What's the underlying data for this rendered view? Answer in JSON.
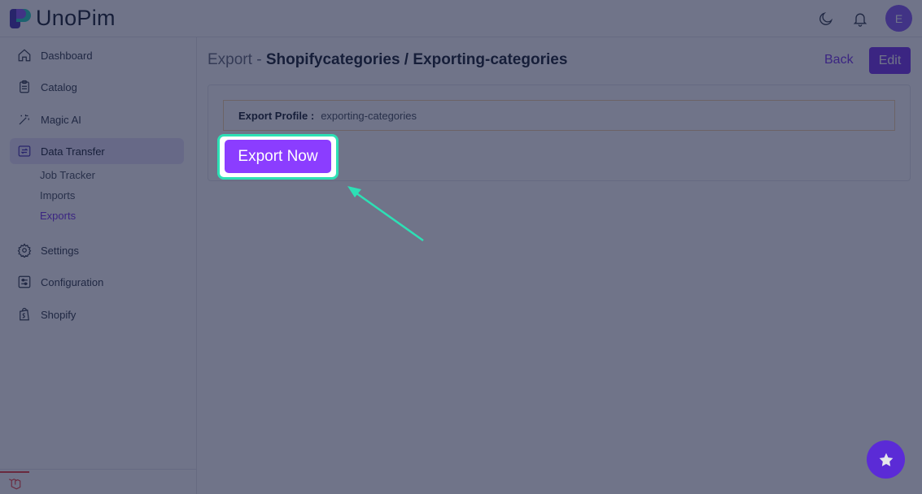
{
  "app": {
    "logo_text": "UnoPim",
    "user_initial": "E",
    "brand_color": "#7c3aed"
  },
  "header": {
    "theme_toggle_icon": "moon-icon",
    "notifications_icon": "bell-icon"
  },
  "sidebar": {
    "items": [
      {
        "label": "Dashboard",
        "icon": "home-icon"
      },
      {
        "label": "Catalog",
        "icon": "clipboard-icon"
      },
      {
        "label": "Magic AI",
        "icon": "magic-wand-icon"
      },
      {
        "label": "Data Transfer",
        "icon": "transfer-icon",
        "active": true
      },
      {
        "label": "Settings",
        "icon": "gear-icon"
      },
      {
        "label": "Configuration",
        "icon": "sliders-icon"
      },
      {
        "label": "Shopify",
        "icon": "shopify-bag-icon"
      }
    ],
    "sub_items": [
      {
        "label": "Job Tracker"
      },
      {
        "label": "Imports"
      },
      {
        "label": "Exports",
        "active": true
      }
    ]
  },
  "main": {
    "title_prefix": "Export",
    "title_separator": " - ",
    "title_main": "Shopifycategories / Exporting-categories",
    "back_label": "Back",
    "edit_label": "Edit",
    "profile_label": "Export Profile :",
    "profile_value": "exporting-categories",
    "export_now_label": "Export Now",
    "highlight_color": "#2de0b5"
  }
}
